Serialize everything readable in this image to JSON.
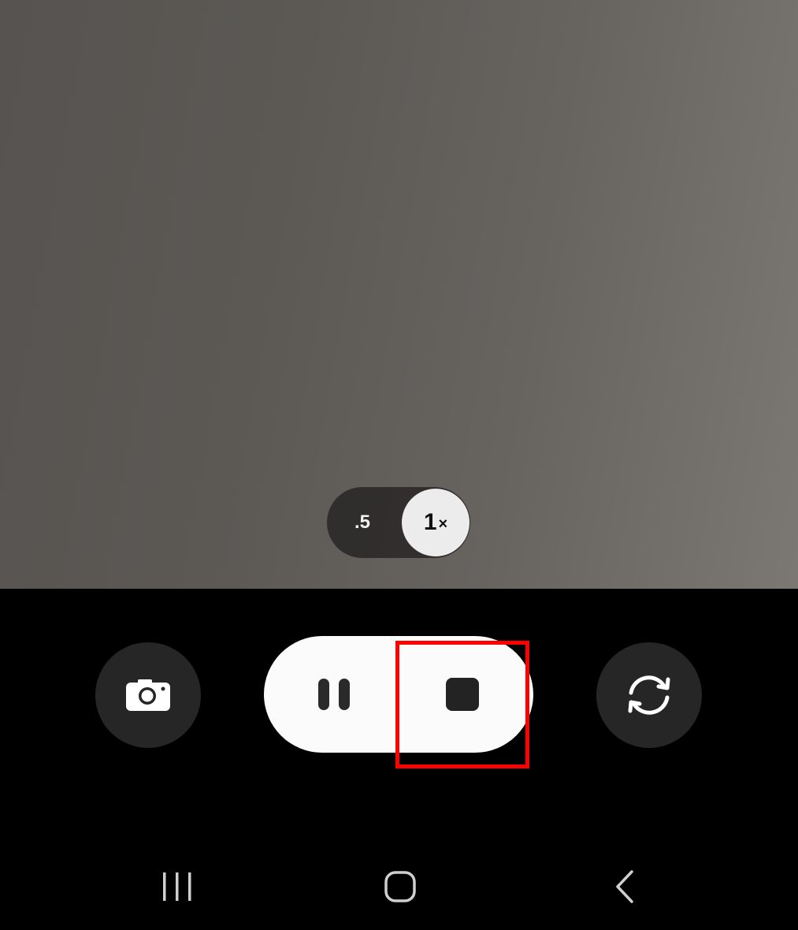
{
  "zoom": {
    "options": [
      ".5",
      "1"
    ],
    "selected_suffix": "×",
    "selected": "1×"
  },
  "record_controls": {
    "pause_icon": "pause-icon",
    "stop_icon": "stop-icon",
    "highlighted": "stop-button"
  },
  "side_buttons": {
    "left_icon": "camera-icon",
    "right_icon": "switch-camera-icon"
  },
  "navigation": {
    "items": [
      "recents-icon",
      "home-icon",
      "back-icon"
    ]
  },
  "colors": {
    "highlight": "#ff0000",
    "pill_background": "#fbfbfb",
    "round_button_background": "#262626",
    "zoom_selected_background": "#ececec"
  }
}
